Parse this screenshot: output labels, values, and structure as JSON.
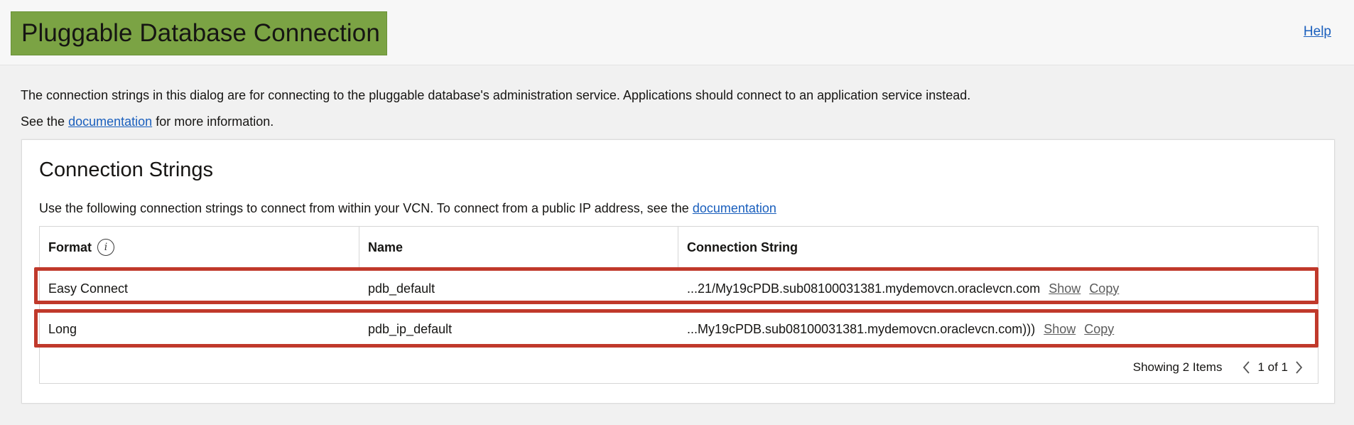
{
  "header": {
    "title": "Pluggable Database Connection",
    "help_label": "Help",
    "title_bg": "#7ba344"
  },
  "intro": {
    "line1": "The connection strings in this dialog are for connecting to the pluggable database's administration service. Applications should connect to an application service instead.",
    "line2_prefix": "See the",
    "line2_link": "documentation",
    "line2_suffix": "for more information."
  },
  "card": {
    "title": "Connection Strings",
    "desc_prefix": "Use the following connection strings to connect from within your VCN. To connect from a public IP address, see the",
    "desc_link": "documentation"
  },
  "table": {
    "columns": [
      "Format",
      "Name",
      "Connection String"
    ],
    "rows": [
      {
        "format": "Easy Connect",
        "name": "pdb_default",
        "connection_string": "...21/My19cPDB.sub08100031381.mydemovcn.oraclevcn.com",
        "show": "Show",
        "copy": "Copy"
      },
      {
        "format": "Long",
        "name": "pdb_ip_default",
        "connection_string": "...My19cPDB.sub08100031381.mydemovcn.oraclevcn.com)))",
        "show": "Show",
        "copy": "Copy"
      }
    ],
    "footer": {
      "showing": "Showing 2 Items",
      "page": "1 of 1"
    }
  },
  "icons": {
    "format_info": "info-icon",
    "prev": "chevron-left-icon",
    "next": "chevron-right-icon"
  },
  "colors": {
    "link": "#1a5fbd",
    "highlight": "#c0392b"
  }
}
